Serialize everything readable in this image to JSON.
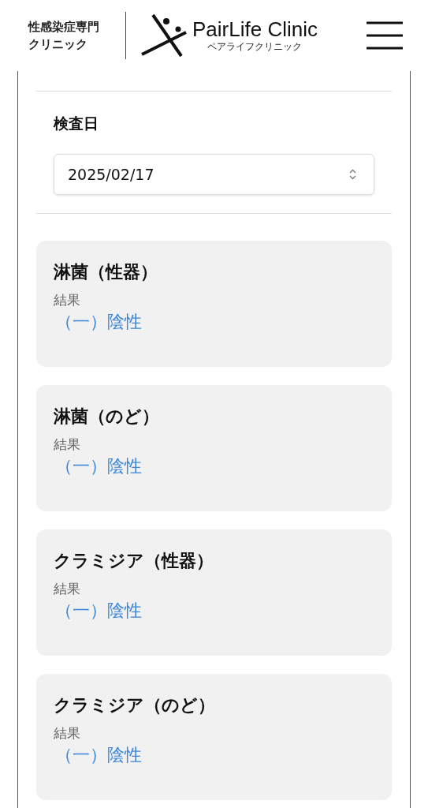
{
  "header": {
    "tagline_lines": [
      "性感染症専門",
      "クリニック"
    ],
    "brand_name": "PairLife Clinic",
    "brand_kana": "ペアライフクリニック"
  },
  "exam_date": {
    "label": "検査日",
    "value": "2025/02/17"
  },
  "results": [
    {
      "test": "淋菌（性器）",
      "result_label": "結果",
      "result": "（一）陰性"
    },
    {
      "test": "淋菌（のど）",
      "result_label": "結果",
      "result": "（一）陰性"
    },
    {
      "test": "クラミジア（性器）",
      "result_label": "結果",
      "result": "（一）陰性"
    },
    {
      "test": "クラミジア（のど）",
      "result_label": "結果",
      "result": "（一）陰性"
    }
  ]
}
